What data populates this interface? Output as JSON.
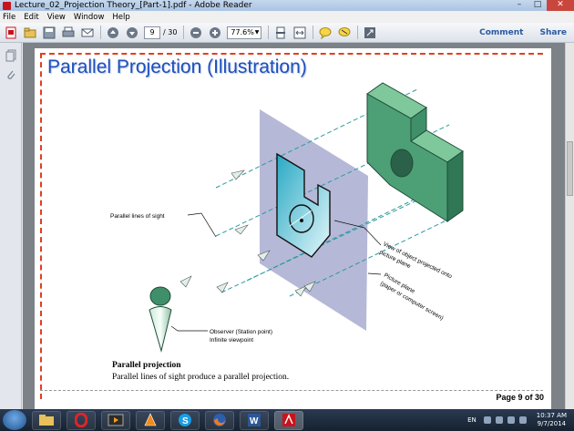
{
  "window": {
    "title": "Lecture_02_Projection Theory_[Part-1].pdf - Adobe Reader",
    "minimize": "–",
    "maximize": "□",
    "close": "✕"
  },
  "menu": [
    "File",
    "Edit",
    "View",
    "Window",
    "Help"
  ],
  "toolbar": {
    "current_page": "9",
    "total_pages": "/ 30",
    "zoom": "77.6%",
    "comment_label": "Comment",
    "share_label": "Share"
  },
  "slide": {
    "title": "Parallel Projection (Illustration)",
    "caption_title": "Parallel projection",
    "caption_text": "Parallel lines of sight produce a parallel projection.",
    "page_label": "Page 9 of 30"
  },
  "figure": {
    "label_lines_of_sight": "Parallel lines of sight",
    "label_observer_1": "Observer (Station point)",
    "label_observer_2": "Infinite viewpoint",
    "label_view_1": "View of object projected onto",
    "label_view_2": "picture plane",
    "label_plane_1": "Picture plane",
    "label_plane_2": "(paper or computer screen)"
  },
  "taskbar": {
    "tasks": [
      "folder",
      "opera",
      "media",
      "vlc",
      "skype",
      "firefox",
      "word",
      "acrobat"
    ],
    "language": "EN",
    "time": "10:37 AM",
    "date": "9/7/2014"
  },
  "colors": {
    "title_blue": "#1d4fbd",
    "object_green": "#3f8f6a",
    "plane_purple": "#9a9cc8",
    "projection_cyan": "#5fc7d8",
    "sight_line_teal": "#2a9aa0"
  }
}
